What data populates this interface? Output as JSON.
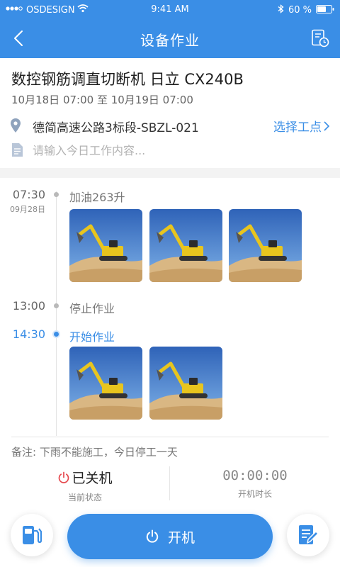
{
  "status_bar": {
    "carrier": "OSDESIGN",
    "time": "9:41 AM",
    "battery": "60 %"
  },
  "nav": {
    "title": "设备作业",
    "back_icon": "chevron-left-icon",
    "action_icon": "schedule-doc-icon"
  },
  "device": {
    "name": "数控钢筋调直切断机 日立 CX240B",
    "date_range": "10月18日 07:00 至 10月19日 07:00"
  },
  "location": {
    "text": "德简高速公路3标段-SBZL-021",
    "select_label": "选择工点"
  },
  "work_content": {
    "value": "",
    "placeholder": "请输入今日工作内容..."
  },
  "timeline": [
    {
      "time": "07:30",
      "date": "09月28日",
      "event": "加油263升",
      "active": false,
      "photo_count": 3
    },
    {
      "time": "13:00",
      "date": "",
      "event": "停止作业",
      "active": false,
      "photo_count": 0
    },
    {
      "time": "14:30",
      "date": "",
      "event": "开始作业",
      "active": true,
      "photo_count": 2
    }
  ],
  "remark": "备注: 下雨不能施工，今日停工一天",
  "status": {
    "value": "已关机",
    "label": "当前状态",
    "icon": "power-icon",
    "icon_color": "#e5484d"
  },
  "runtime": {
    "value": "00:00:00",
    "label": "开机时长"
  },
  "actions": {
    "start_label": "开机",
    "fuel_icon": "fuel-pump-icon",
    "edit_icon": "edit-document-icon"
  },
  "colors": {
    "primary": "#3a8ee6",
    "status_off": "#e5484d"
  }
}
